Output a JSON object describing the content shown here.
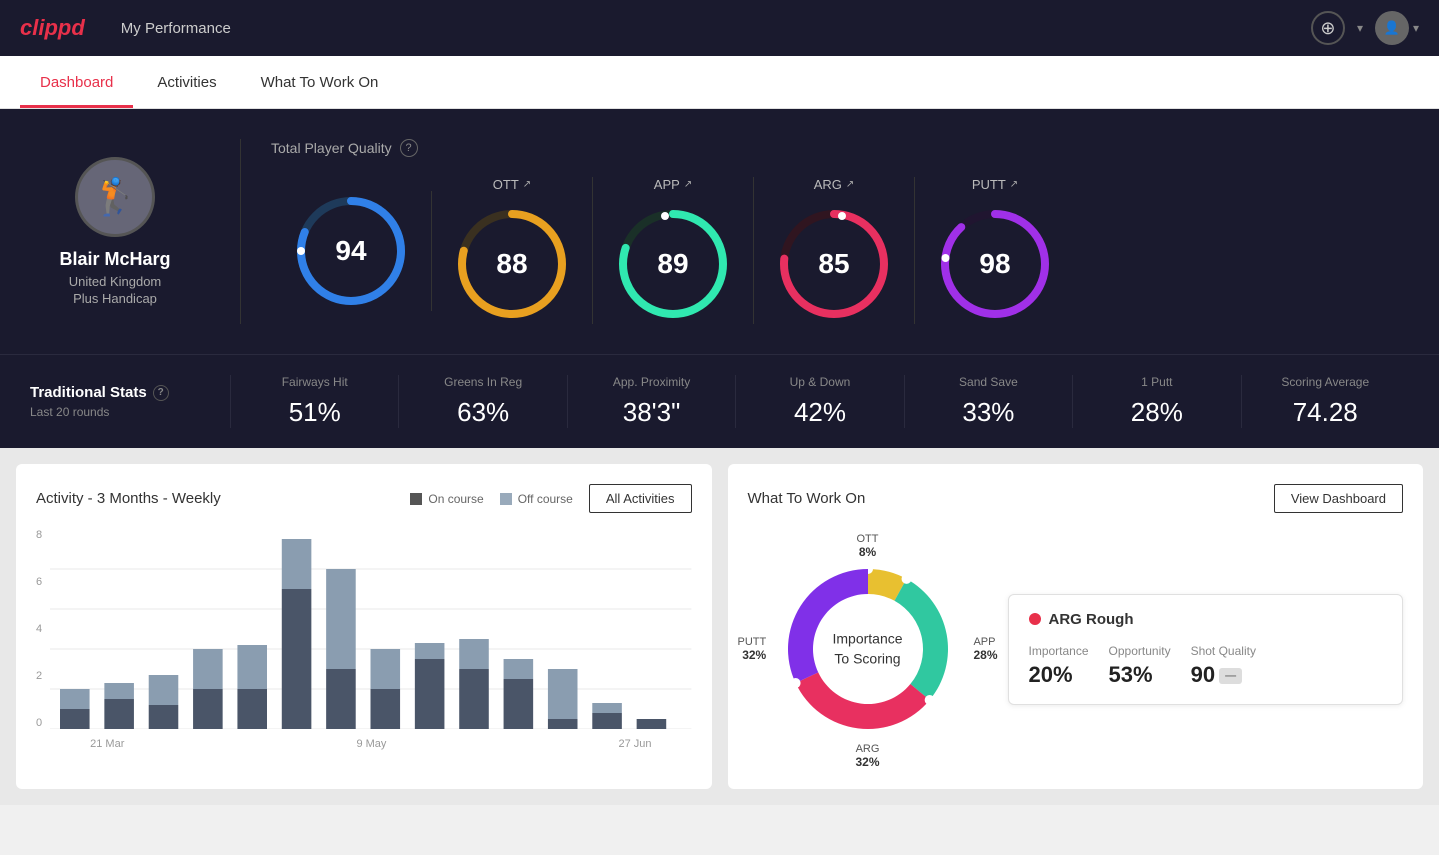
{
  "app": {
    "logo": "clippd",
    "header_title": "My Performance"
  },
  "tabs": [
    {
      "id": "dashboard",
      "label": "Dashboard",
      "active": true
    },
    {
      "id": "activities",
      "label": "Activities",
      "active": false
    },
    {
      "id": "what-to-work-on",
      "label": "What To Work On",
      "active": false
    }
  ],
  "player": {
    "name": "Blair McHarg",
    "country": "United Kingdom",
    "handicap": "Plus Handicap",
    "avatar_emoji": "🏌️"
  },
  "quality": {
    "label": "Total Player Quality",
    "main_score": 94,
    "metrics": [
      {
        "id": "ott",
        "label": "OTT",
        "value": 88,
        "color": "#e8a020",
        "track_color": "#3a3020"
      },
      {
        "id": "app",
        "label": "APP",
        "value": 89,
        "color": "#30e8b0",
        "track_color": "#1a3028"
      },
      {
        "id": "arg",
        "label": "ARG",
        "value": 85,
        "color": "#e83060",
        "track_color": "#301520"
      },
      {
        "id": "putt",
        "label": "PUTT",
        "value": 98,
        "color": "#a030e8",
        "track_color": "#201530"
      }
    ]
  },
  "traditional_stats": {
    "title": "Traditional Stats",
    "subtitle": "Last 20 rounds",
    "items": [
      {
        "name": "Fairways Hit",
        "value": "51%"
      },
      {
        "name": "Greens In Reg",
        "value": "63%"
      },
      {
        "name": "App. Proximity",
        "value": "38'3\""
      },
      {
        "name": "Up & Down",
        "value": "42%"
      },
      {
        "name": "Sand Save",
        "value": "33%"
      },
      {
        "name": "1 Putt",
        "value": "28%"
      },
      {
        "name": "Scoring Average",
        "value": "74.28"
      }
    ]
  },
  "activity_chart": {
    "title": "Activity - 3 Months - Weekly",
    "legend": {
      "on_course": "On course",
      "off_course": "Off course"
    },
    "all_activities_btn": "All Activities",
    "x_labels": [
      "21 Mar",
      "9 May",
      "27 Jun"
    ],
    "bars": [
      {
        "on": 1,
        "off": 1
      },
      {
        "on": 1.5,
        "off": 0.8
      },
      {
        "on": 1.2,
        "off": 1.5
      },
      {
        "on": 2,
        "off": 2
      },
      {
        "on": 2,
        "off": 2.2
      },
      {
        "on": 7,
        "off": 2.5
      },
      {
        "on": 3,
        "off": 5
      },
      {
        "on": 2,
        "off": 2
      },
      {
        "on": 3.5,
        "off": 0.8
      },
      {
        "on": 3,
        "off": 1.5
      },
      {
        "on": 2.5,
        "off": 1
      },
      {
        "on": 0.5,
        "off": 2.5
      },
      {
        "on": 0.8,
        "off": 0.5
      },
      {
        "on": 0.5,
        "off": 0
      }
    ],
    "y_labels": [
      "0",
      "2",
      "4",
      "6",
      "8"
    ]
  },
  "what_to_work_on": {
    "title": "What To Work On",
    "view_btn": "View Dashboard",
    "donut_center_line1": "Importance",
    "donut_center_line2": "To Scoring",
    "segments": [
      {
        "label": "OTT",
        "percent": "8%",
        "value": 8,
        "color": "#e8c030"
      },
      {
        "label": "APP",
        "percent": "28%",
        "value": 28,
        "color": "#30c8a0"
      },
      {
        "label": "ARG",
        "percent": "32%",
        "value": 32,
        "color": "#e83060"
      },
      {
        "label": "PUTT",
        "percent": "32%",
        "value": 32,
        "color": "#8030e8"
      }
    ],
    "card": {
      "title": "ARG Rough",
      "metrics": [
        {
          "label": "Importance",
          "value": "20%"
        },
        {
          "label": "Opportunity",
          "value": "53%"
        },
        {
          "label": "Shot Quality",
          "value": "90",
          "badge": ""
        }
      ]
    }
  }
}
